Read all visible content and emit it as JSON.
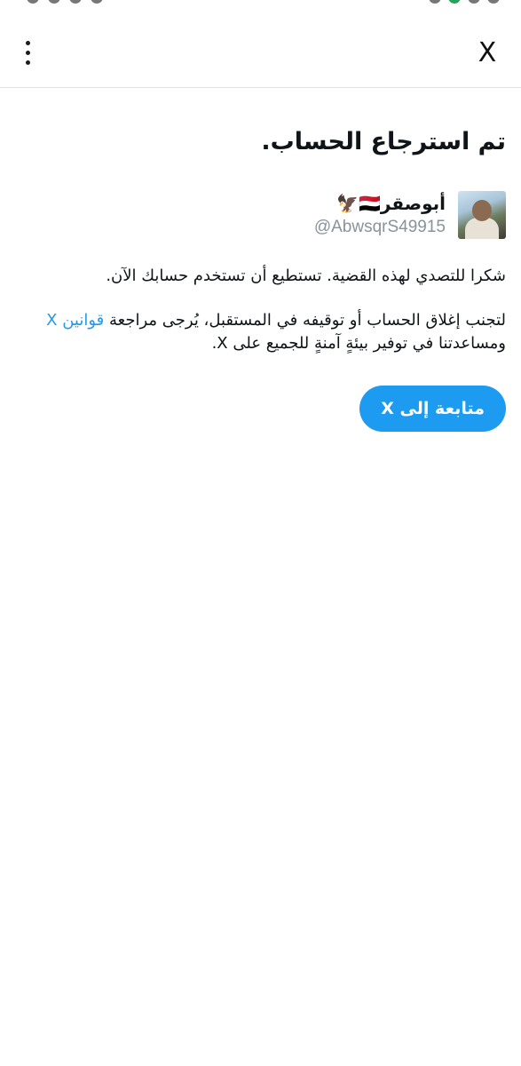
{
  "app_bar": {
    "close_label": "X",
    "menu_icon": "more-vertical-icon"
  },
  "page": {
    "title": "تم استرجاع الحساب."
  },
  "account": {
    "display_name": "أبوصقر🇾🇪🦅",
    "handle": "@AbwsqrS49915"
  },
  "message": {
    "thanks": "شكرا للتصدي لهذه القضية. تستطيع أن تستخدم حسابك الآن.",
    "avoid_prefix": "لتجنب إغلاق الحساب أو توقيفه في المستقبل، يُرجى مراجعة ",
    "rules_link": "قوانين X",
    "avoid_suffix": " ومساعدتنا في توفير بيئةٍ آمنةٍ للجميع على X."
  },
  "continue_button": {
    "label": "متابعة إلى X"
  },
  "colors": {
    "accent": "#1d9bf0",
    "text": "#0f1419",
    "secondary_text": "#8a9299"
  }
}
